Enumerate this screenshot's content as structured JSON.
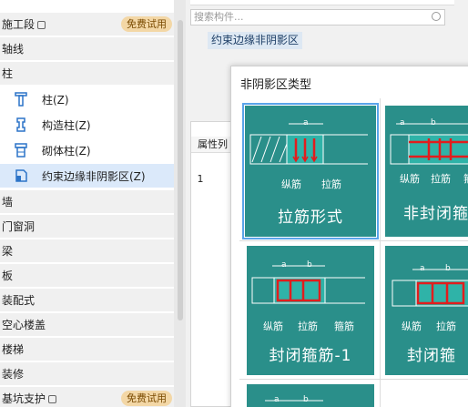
{
  "tree": {
    "categories": [
      {
        "label": "施工段",
        "badge": "免费试用",
        "lock": true
      },
      {
        "label": "轴线"
      },
      {
        "label": "柱"
      }
    ],
    "column_items": [
      {
        "label": "柱(Z)",
        "icon": "column-icon"
      },
      {
        "label": "构造柱(Z)",
        "icon": "structural-column-icon"
      },
      {
        "label": "砌体柱(Z)",
        "icon": "masonry-column-icon"
      },
      {
        "label": "约束边缘非阴影区(Z)",
        "icon": "constrained-edge-icon",
        "selected": true
      }
    ],
    "more_categories": [
      {
        "label": "墙"
      },
      {
        "label": "门窗洞"
      },
      {
        "label": "梁"
      },
      {
        "label": "板"
      },
      {
        "label": "装配式"
      },
      {
        "label": "空心楼盖"
      },
      {
        "label": "楼梯"
      },
      {
        "label": "装修"
      },
      {
        "label": "基坑支护",
        "badge": "免费试用",
        "lock": true
      }
    ]
  },
  "middle": {
    "search_placeholder": "搜索构件...",
    "selected_tag": "约束边缘非阴影区",
    "prop_header": "属性列",
    "row_num": "1"
  },
  "dialog": {
    "title": "非阴影区类型",
    "cards": [
      {
        "name": "拉筋形式",
        "caps": [
          "纵筋",
          "拉筋"
        ],
        "dims": [
          "a"
        ]
      },
      {
        "name": "非封闭箍",
        "caps": [
          "纵筋",
          "拉筋",
          "箍"
        ],
        "dims": [
          "a",
          "b"
        ]
      },
      {
        "name": "封闭箍筋-1",
        "caps": [
          "纵筋",
          "拉筋",
          "箍筋"
        ],
        "dims": [
          "a",
          "b"
        ]
      },
      {
        "name": "封闭箍",
        "caps": [
          "纵筋",
          "拉筋"
        ],
        "dims": [
          "a",
          "b"
        ]
      },
      {
        "name": "",
        "caps": [],
        "dims": [
          "a",
          "b"
        ]
      }
    ]
  },
  "colors": {
    "card": "#2a8f8a",
    "accent": "#5aa4ea",
    "badge": "#f3d7a6"
  }
}
